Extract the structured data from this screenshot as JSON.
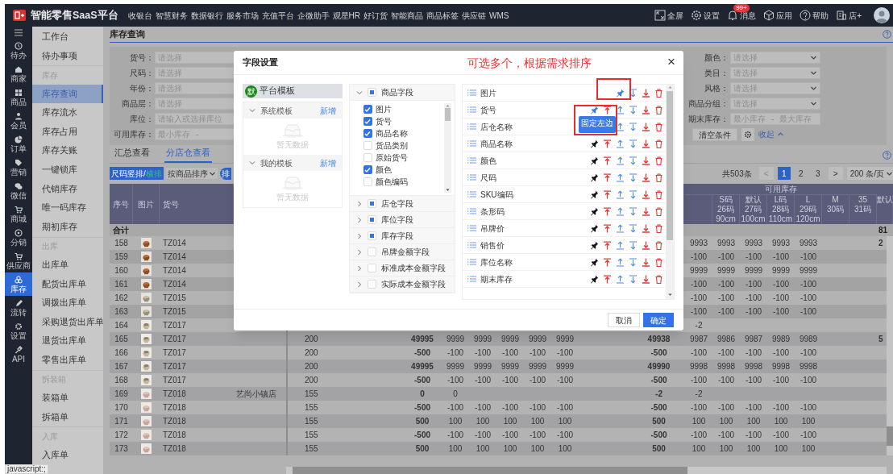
{
  "top_bar": {
    "title": "智能零售SaaS平台",
    "nav": [
      "收银台",
      "智慧财务",
      "数据银行",
      "服务市场",
      "充值平台",
      "企微助手",
      "观星HR",
      "好订货",
      "智能商品",
      "商品标签",
      "供应链",
      "WMS"
    ],
    "tools": [
      {
        "kind": "fullscreen",
        "label": "全屏"
      },
      {
        "kind": "settings",
        "label": "设置"
      },
      {
        "kind": "bell",
        "label": "消息",
        "badge": "99+"
      },
      {
        "kind": "cube",
        "label": "应用"
      },
      {
        "kind": "help",
        "label": "帮助"
      },
      {
        "kind": "store",
        "label": "店+"
      }
    ]
  },
  "rail": [
    {
      "kind": "clock",
      "label": "待办",
      "selected": false
    },
    {
      "kind": "home",
      "label": "商家",
      "selected": false
    },
    {
      "kind": "grid",
      "label": "商品",
      "selected": false
    },
    {
      "kind": "user",
      "label": "会员",
      "selected": false
    },
    {
      "kind": "pie",
      "label": "订单",
      "selected": false
    },
    {
      "kind": "tag",
      "label": "营销",
      "selected": false
    },
    {
      "kind": "chat",
      "label": "微信",
      "selected": false
    },
    {
      "kind": "cart",
      "label": "商城",
      "selected": false
    },
    {
      "kind": "share",
      "label": "分销",
      "selected": false
    },
    {
      "kind": "cart",
      "label": "供应商",
      "selected": false
    },
    {
      "kind": "stack",
      "label": "库存",
      "selected": true
    },
    {
      "kind": "pen",
      "label": "流转",
      "selected": false
    },
    {
      "kind": "gear",
      "label": "设置",
      "selected": false
    },
    {
      "kind": "plug",
      "label": "API",
      "selected": false
    }
  ],
  "menu": [
    {
      "kind": "item",
      "label": "工作台",
      "selected": false
    },
    {
      "kind": "item",
      "label": "待办事项",
      "selected": false
    },
    {
      "kind": "group",
      "label": "库存"
    },
    {
      "kind": "item",
      "label": "库存查询",
      "selected": true
    },
    {
      "kind": "item",
      "label": "库存流水",
      "selected": false
    },
    {
      "kind": "item",
      "label": "库存占用",
      "selected": false
    },
    {
      "kind": "item",
      "label": "库存关账",
      "selected": false
    },
    {
      "kind": "item",
      "label": "一键锁库",
      "selected": false
    },
    {
      "kind": "item",
      "label": "代销库存",
      "selected": false
    },
    {
      "kind": "item",
      "label": "唯一码库存",
      "selected": false
    },
    {
      "kind": "item",
      "label": "期初库存",
      "selected": false
    },
    {
      "kind": "group",
      "label": "出库"
    },
    {
      "kind": "item",
      "label": "出库单",
      "selected": false
    },
    {
      "kind": "item",
      "label": "配货出库单",
      "selected": false
    },
    {
      "kind": "item",
      "label": "调拨出库单",
      "selected": false
    },
    {
      "kind": "item",
      "label": "采购退货出库单",
      "selected": false
    },
    {
      "kind": "item",
      "label": "退货出库单",
      "selected": false
    },
    {
      "kind": "item",
      "label": "零售出库单",
      "selected": false
    },
    {
      "kind": "group",
      "label": "拆装箱"
    },
    {
      "kind": "item",
      "label": "装箱单",
      "selected": false
    },
    {
      "kind": "item",
      "label": "拆箱单",
      "selected": false
    },
    {
      "kind": "group",
      "label": "入库"
    },
    {
      "kind": "item",
      "label": "入库单",
      "selected": false
    }
  ],
  "page_title": "库存查询",
  "filters_left": [
    {
      "kind": "select",
      "label": "货号：",
      "placeholder": "请选择"
    },
    {
      "kind": "select",
      "label": "尺码：",
      "placeholder": "请选择"
    },
    {
      "kind": "select",
      "label": "年份：",
      "placeholder": "请选择"
    },
    {
      "kind": "select",
      "label": "商品层：",
      "placeholder": "请选择"
    },
    {
      "kind": "input",
      "label": "库位：",
      "placeholder": "请输入或选择库位"
    },
    {
      "kind": "range",
      "label": "可用库存：",
      "placeholder": "最小库存",
      "separator": "-"
    }
  ],
  "filters_right": [
    {
      "kind": "select",
      "label": "颜色：",
      "placeholder": "请选择"
    },
    {
      "kind": "select",
      "label": "类目：",
      "placeholder": "请选择"
    },
    {
      "kind": "select",
      "label": "风格：",
      "placeholder": "请选择"
    },
    {
      "kind": "select",
      "label": "商品分组：",
      "placeholder": "请选择"
    },
    {
      "kind": "range",
      "label": "期末库存：",
      "placeholder": "最小库存",
      "separator": "-",
      "placeholder_2": "最大库存"
    }
  ],
  "filter_actions": {
    "clear": "清空条件",
    "collapse": "收起"
  },
  "view_tabs": [
    {
      "label": "汇总查看",
      "selected": false
    },
    {
      "label": "分店仓查看",
      "selected": true
    }
  ],
  "toolbar": {
    "layout_button": [
      "尺码竖排/",
      "横排"
    ],
    "sort_select": "按商品排序",
    "pill": "排"
  },
  "pagination": {
    "total": "共503条",
    "prev": "<",
    "pages": [
      {
        "label": "1",
        "selected": true
      },
      {
        "label": "2",
        "selected": false
      },
      {
        "label": "3",
        "selected": false
      }
    ],
    "next": ">",
    "page_size": "200 条/页"
  },
  "table": {
    "columns": [
      "序号",
      "图片",
      "货号"
    ],
    "size_group": "可用库存",
    "size_columns": [
      [
        "S码",
        "26码",
        "90cm"
      ],
      [
        "默认",
        "27码",
        "100cm"
      ],
      [
        "L码",
        "28码",
        "110cm"
      ],
      [
        "L",
        "29码",
        "120cm"
      ],
      [
        "M",
        "30码"
      ],
      [
        "35",
        "31码"
      ],
      [
        "默认"
      ]
    ],
    "total_row": {
      "label": "合计",
      "tail": "81"
    },
    "rows": [
      {
        "no": "158",
        "code": "TZ014",
        "b": [
          "9993",
          "9993",
          "9993",
          "9993",
          "9993"
        ],
        "tail": "2"
      },
      {
        "no": "159",
        "code": "TZ014",
        "b": [
          "-100",
          "-100",
          "-100",
          "-100",
          "-100"
        ]
      },
      {
        "no": "160",
        "code": "TZ014",
        "b": [
          "9999",
          "9999",
          "9999",
          "9999",
          "9999"
        ]
      },
      {
        "no": "161",
        "code": "TZ014",
        "b": [
          "-100",
          "-100",
          "-100",
          "-100",
          "-100"
        ]
      },
      {
        "no": "162",
        "code": "TZ015",
        "b": [
          "-100",
          "-100",
          "-100",
          "-100",
          "-100"
        ]
      },
      {
        "no": "163",
        "code": "TZ015",
        "b": [
          "-100",
          "-100",
          "-100",
          "-100",
          "-100"
        ]
      },
      {
        "no": "164",
        "code": "TZ017",
        "b": [
          "-2"
        ]
      },
      {
        "no": "165",
        "code": "TZ017",
        "qty": "200",
        "total_a": "49995",
        "a": [
          "9999",
          "9999",
          "9999",
          "9999",
          "9999"
        ],
        "total_b": "49938",
        "b": [
          "9987",
          "9986",
          "9987",
          "9989",
          "9989"
        ],
        "tail": "5"
      },
      {
        "no": "166",
        "code": "TZ017",
        "qty": "200",
        "total_a": "-500",
        "a": [
          "-100",
          "-100",
          "-100",
          "-100",
          "-100"
        ],
        "total_b": "-500",
        "b": [
          "-100",
          "-100",
          "-100",
          "-100",
          "-100"
        ]
      },
      {
        "no": "167",
        "code": "TZ017",
        "qty": "200",
        "total_a": "49995",
        "a": [
          "9999",
          "9999",
          "9999",
          "9999",
          "9999"
        ],
        "total_b": "49990",
        "b": [
          "9998",
          "9998",
          "9998",
          "9998",
          "9998"
        ]
      },
      {
        "no": "168",
        "code": "TZ017",
        "qty": "200",
        "total_a": "-500",
        "a": [
          "-100",
          "-100",
          "-100",
          "-100",
          "-100"
        ],
        "total_b": "-500",
        "b": [
          "-100",
          "-100",
          "-100",
          "-100",
          "-100"
        ]
      },
      {
        "no": "169",
        "code": "TZ018",
        "store": "艺尚小镇店",
        "qty": "155",
        "total_a": "0",
        "a": [
          "0"
        ],
        "total_b": "-2",
        "b": [
          "-2"
        ]
      },
      {
        "no": "170",
        "code": "TZ018",
        "qty": "155",
        "total_a": "-500",
        "a": [
          "-100",
          "-100",
          "-100",
          "-100",
          "-100"
        ],
        "total_b": "-500",
        "b": [
          "-100",
          "-100",
          "-100",
          "-100",
          "-100"
        ]
      },
      {
        "no": "171",
        "code": "TZ018",
        "qty": "155",
        "total_a": "500",
        "a": [
          "100",
          "100",
          "100",
          "100",
          "100"
        ],
        "total_b": "500",
        "b": [
          "100",
          "100",
          "100",
          "100",
          "100"
        ]
      },
      {
        "no": "172",
        "code": "TZ018",
        "qty": "155",
        "total_a": "-500",
        "a": [
          "-100",
          "-100",
          "-100",
          "-100",
          "-100"
        ],
        "total_b": "-500",
        "b": [
          "-100",
          "-100",
          "-100",
          "-100",
          "-100"
        ]
      },
      {
        "no": "173",
        "code": "TZ018",
        "qty": "155",
        "total_a": "500",
        "a": [
          "100",
          "100",
          "100",
          "100",
          "100"
        ],
        "total_b": "500",
        "b": [
          "100",
          "100",
          "100",
          "100",
          "100"
        ]
      }
    ]
  },
  "status": "javascript:;",
  "dialog": {
    "title": "字段设置",
    "annotation": "可选多个，根据需求排序",
    "close": "×",
    "platform_template": {
      "badge": "默",
      "label": "平台模板"
    },
    "template_sections": [
      {
        "label": "系统模板",
        "action": "新增",
        "empty": "暂无数据",
        "expanded": true
      },
      {
        "label": "我的模板",
        "action": "新增",
        "empty": "暂无数据",
        "expanded": true
      }
    ],
    "field_groups": [
      {
        "label": "商品字段",
        "indeterminate": true,
        "expanded": true,
        "items": [
          {
            "label": "图片",
            "checked": true
          },
          {
            "label": "货号",
            "checked": true
          },
          {
            "label": "商品名称",
            "checked": true
          },
          {
            "label": "货品类别",
            "checked": false
          },
          {
            "label": "原始货号",
            "checked": false
          },
          {
            "label": "颜色",
            "checked": true
          },
          {
            "label": "颜色编码",
            "checked": false
          }
        ]
      },
      {
        "label": "店仓字段",
        "indeterminate": true,
        "expanded": false
      },
      {
        "label": "库位字段",
        "indeterminate": true,
        "expanded": false
      },
      {
        "label": "库存字段",
        "indeterminate": true,
        "expanded": false
      },
      {
        "label": "吊牌金额字段",
        "indeterminate": false,
        "expanded": false
      },
      {
        "label": "标准成本金额字段",
        "indeterminate": false,
        "expanded": false
      },
      {
        "label": "实际成本金额字段",
        "indeterminate": false,
        "expanded": false
      }
    ],
    "selected_fields": [
      {
        "label": "图片",
        "pinned": true
      },
      {
        "label": "货号",
        "pinned": true,
        "tooltip": "固定左边"
      },
      {
        "label": "店仓名称"
      },
      {
        "label": "商品名称",
        "pinned": false
      },
      {
        "label": "颜色",
        "pinned": false
      },
      {
        "label": "尺码",
        "pinned": false
      },
      {
        "label": "SKU编码",
        "pinned": false
      },
      {
        "label": "条形码",
        "pinned": false
      },
      {
        "label": "吊牌价",
        "pinned": false
      },
      {
        "label": "销售价",
        "pinned": false
      },
      {
        "label": "库位名称",
        "pinned": false
      },
      {
        "label": "期末库存",
        "pinned": false
      }
    ],
    "buttons": [
      {
        "kind": "secondary",
        "label": "取消"
      },
      {
        "kind": "primary",
        "label": "确定"
      }
    ]
  }
}
